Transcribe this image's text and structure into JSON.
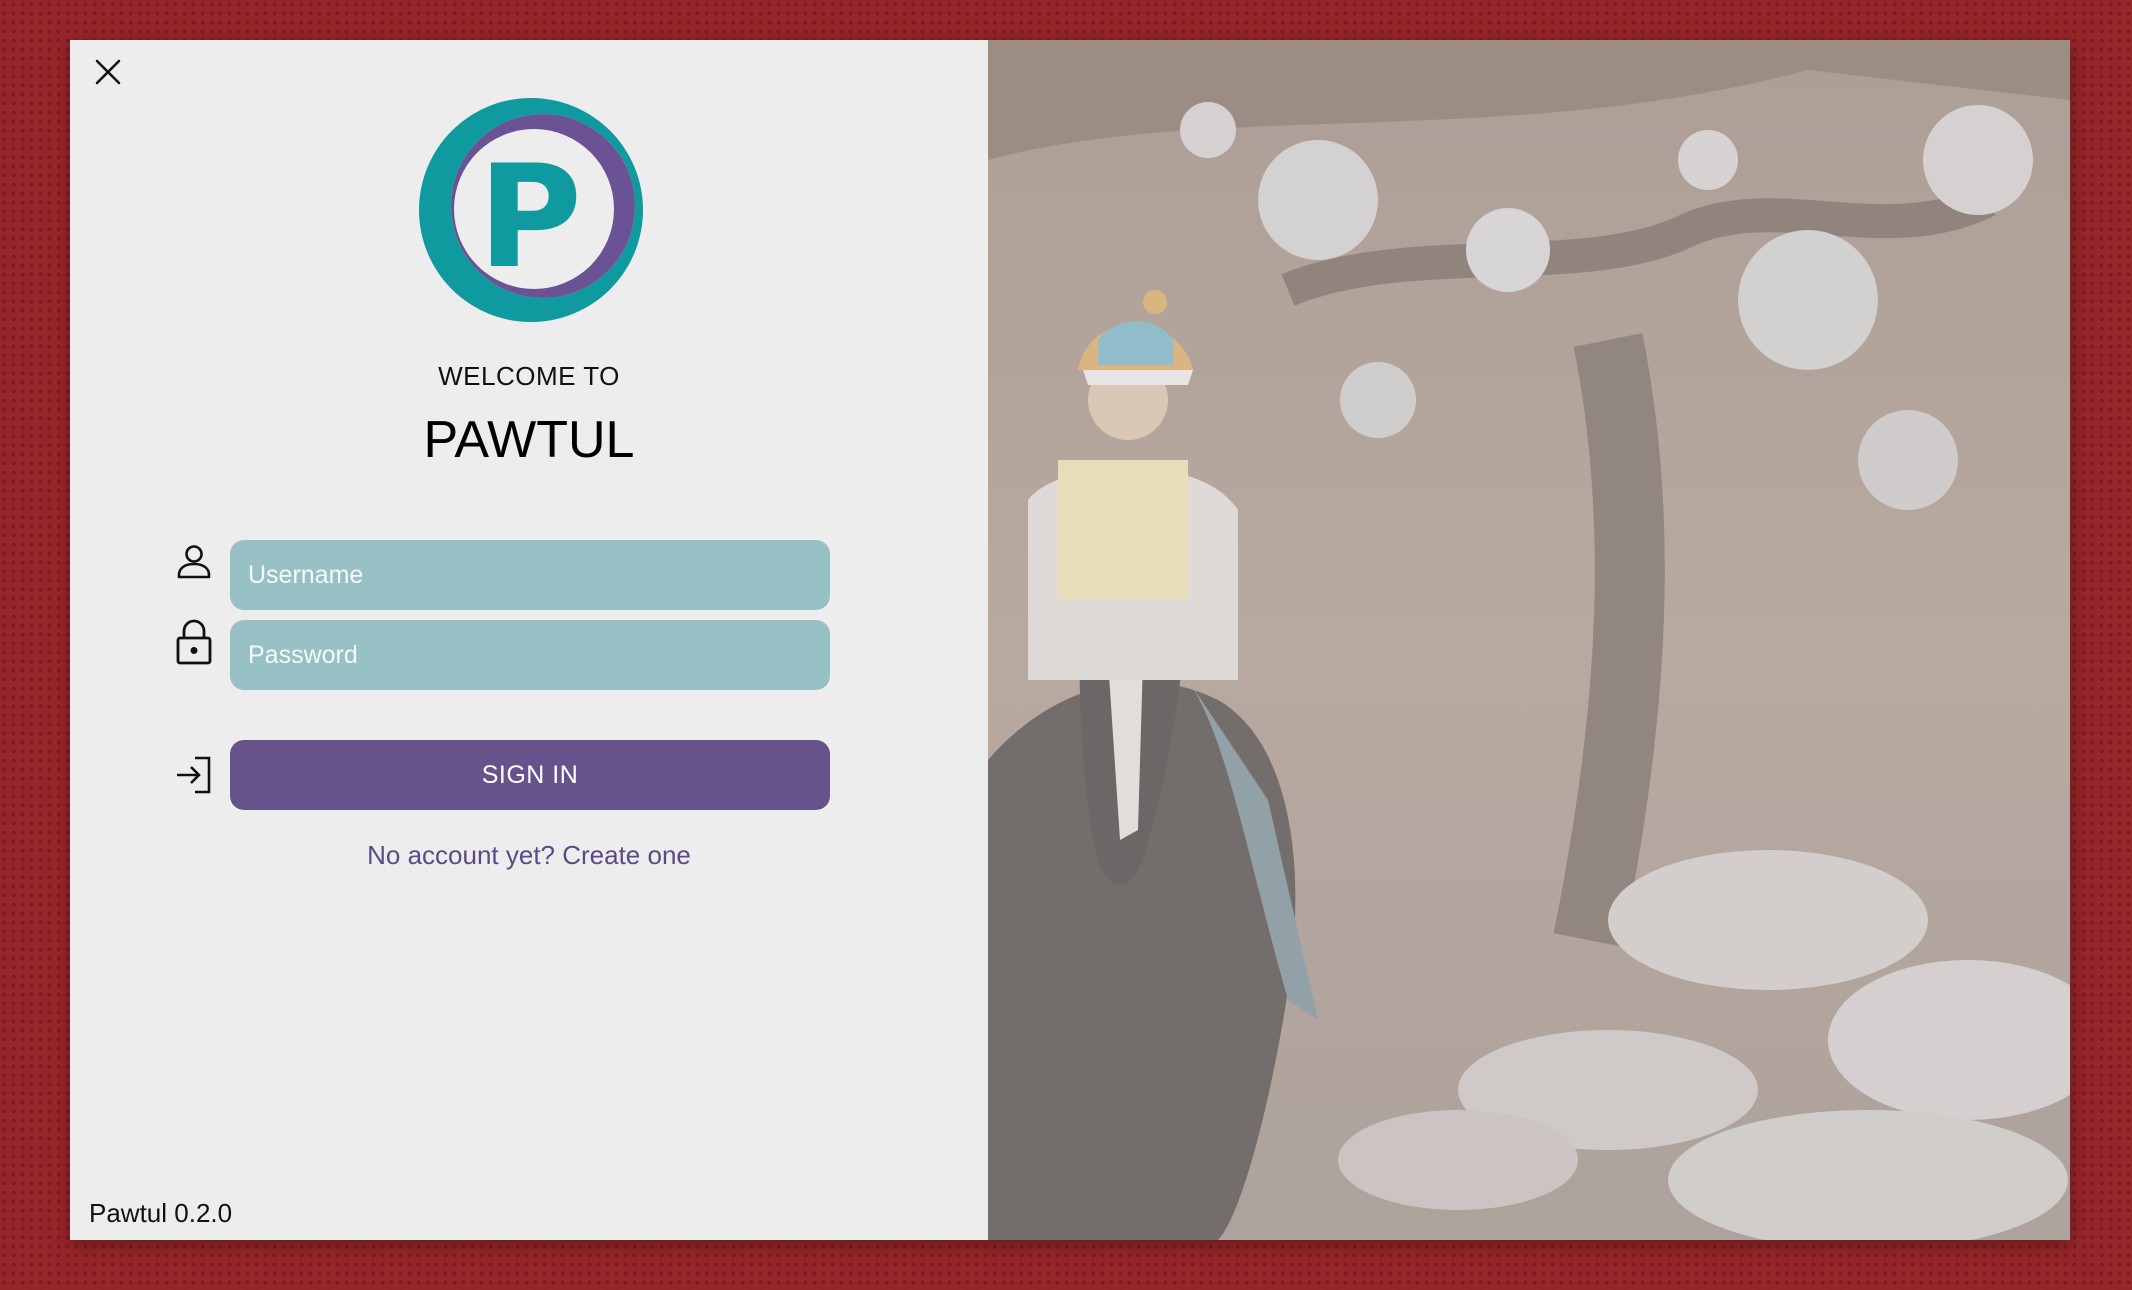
{
  "window": {
    "close_icon": "close-icon"
  },
  "login": {
    "logo_letter": "P",
    "welcome_text": "WELCOME TO",
    "app_name": "PAWTUL",
    "username_placeholder": "Username",
    "password_placeholder": "Password",
    "username_icon": "user-icon",
    "password_icon": "lock-icon",
    "signin_icon": "sign-in-icon",
    "signin_label": "SIGN IN",
    "create_account_link": "No account yet? Create one",
    "version": "Pawtul 0.2.0"
  },
  "colors": {
    "logo_teal": "#0f9aa0",
    "logo_purple": "#6a5294",
    "input_background": "#97c1c5",
    "button_background": "#66538c",
    "link_color": "#5a4a86",
    "panel_background": "#ededed",
    "desktop_background": "#97262a"
  }
}
